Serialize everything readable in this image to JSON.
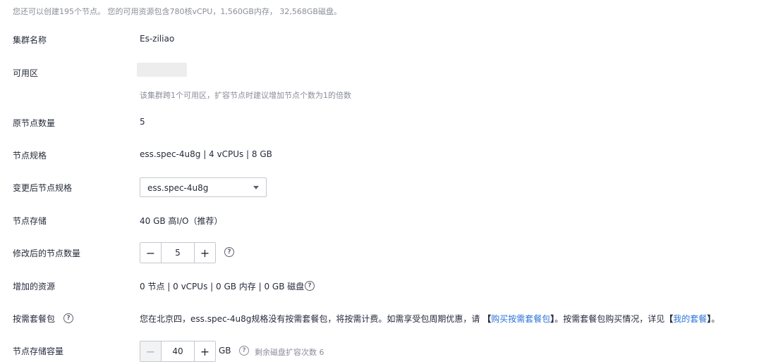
{
  "top_note": "您还可以创建195个节点。 您的可用资源包含780核vCPU，1,560GB内存， 32,568GB磁盘。",
  "cluster_name": {
    "label": "集群名称",
    "value": "Es-ziliao"
  },
  "az": {
    "label": "可用区",
    "hint": "该集群跨1个可用区，扩容节点时建议增加节点个数为1的倍数"
  },
  "original_nodes": {
    "label": "原节点数量",
    "value": "5"
  },
  "node_spec": {
    "label": "节点规格",
    "value": "ess.spec-4u8g | 4 vCPUs | 8 GB"
  },
  "new_spec": {
    "label": "变更后节点规格",
    "selected": "ess.spec-4u8g"
  },
  "node_storage": {
    "label": "节点存储",
    "value": "40 GB 高I/O（推荐）"
  },
  "modified_nodes": {
    "label": "修改后的节点数量",
    "value": "5",
    "minus": "−",
    "plus": "+"
  },
  "added_resources": {
    "label": "增加的资源",
    "value": "0 节点 | 0 vCPUs | 0 GB 内存 | 0 GB 磁盘"
  },
  "package": {
    "label": "按需套餐包",
    "text_before": "您在北京四，ess.spec-4u8g规格没有按需套餐包，将按需计费。如需享受包周期优惠，请",
    "bracket_open": "【",
    "bracket_close": "】",
    "buy_link": "购买按需套餐包",
    "text_middle": "。按需套餐包购买情况，详见",
    "my_link": "我的套餐",
    "text_end": "。"
  },
  "storage_capacity": {
    "label": "节点存储容量",
    "value": "40",
    "unit": "GB",
    "remaining": "剩余磁盘扩容次数 6",
    "minus": "−",
    "plus": "+"
  },
  "help_glyph": "?"
}
